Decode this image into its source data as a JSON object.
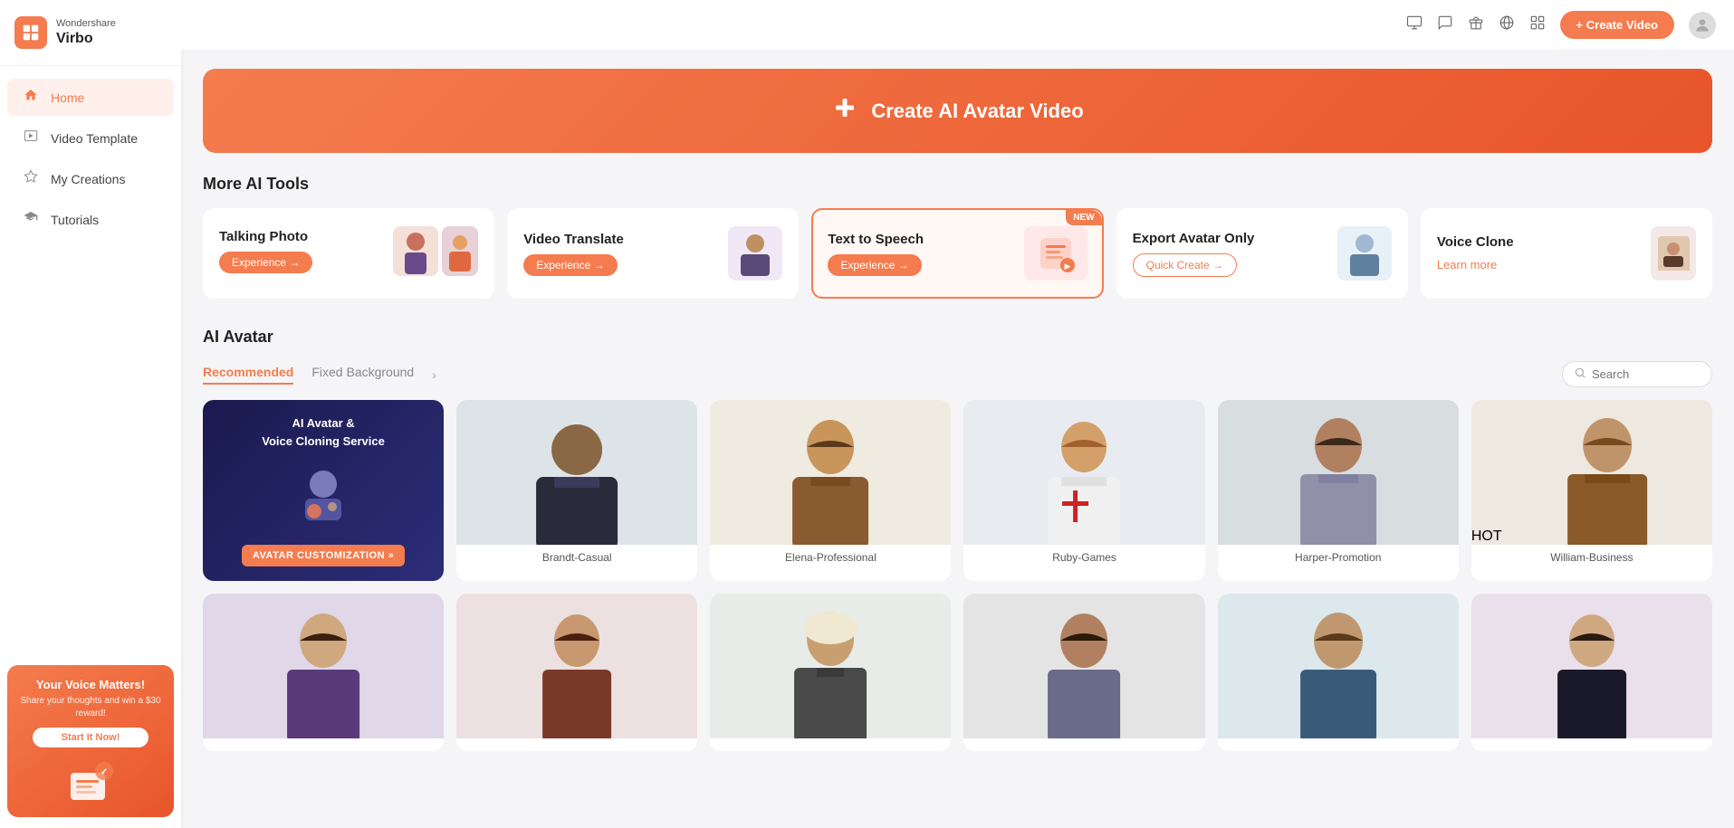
{
  "app": {
    "brand_top": "Wondershare",
    "brand_name": "Virbo",
    "logo_icon": "🎬"
  },
  "sidebar": {
    "items": [
      {
        "id": "home",
        "label": "Home",
        "icon": "🏠",
        "active": true
      },
      {
        "id": "video-template",
        "label": "Video Template",
        "icon": "📋",
        "active": false
      },
      {
        "id": "my-creations",
        "label": "My Creations",
        "icon": "🎓",
        "active": false
      },
      {
        "id": "tutorials",
        "label": "Tutorials",
        "icon": "🎓",
        "active": false
      }
    ]
  },
  "topbar": {
    "create_video_label": "+ Create Video",
    "icons": [
      "monitor",
      "message",
      "gift",
      "globe",
      "grid"
    ]
  },
  "voice_banner": {
    "title": "Your Voice Matters!",
    "desc": "Share your thoughts and win a $30 reward!",
    "button_label": "Start It Now!"
  },
  "hero": {
    "title": "Create AI Avatar Video",
    "icon": "➕"
  },
  "more_ai_tools": {
    "section_title": "More AI Tools",
    "tools": [
      {
        "id": "talking-photo",
        "title": "Talking Photo",
        "button_label": "Experience →",
        "button_type": "filled",
        "new_badge": false,
        "highlighted": false
      },
      {
        "id": "video-translate",
        "title": "Video Translate",
        "button_label": "Experience →",
        "button_type": "filled",
        "new_badge": false,
        "highlighted": false
      },
      {
        "id": "text-to-speech",
        "title": "Text to Speech",
        "button_label": "Experience →",
        "button_type": "filled",
        "new_badge": true,
        "badge_text": "NEW",
        "highlighted": true
      },
      {
        "id": "export-avatar",
        "title": "Export Avatar Only",
        "button_label": "Quick Create →",
        "button_type": "outline",
        "new_badge": false,
        "highlighted": false
      },
      {
        "id": "voice-clone",
        "title": "Voice Clone",
        "button_label": "Learn more",
        "button_type": "link",
        "new_badge": false,
        "highlighted": false
      }
    ]
  },
  "ai_avatar": {
    "section_title": "AI Avatar",
    "tabs": [
      {
        "id": "recommended",
        "label": "Recommended",
        "active": true
      },
      {
        "id": "fixed-background",
        "label": "Fixed Background",
        "active": false
      }
    ],
    "search_placeholder": "Search",
    "avatars": [
      {
        "id": "promo",
        "type": "promo",
        "title": "AI Avatar & Voice Cloning Service",
        "button_label": "AVATAR CUSTOMIZATION »"
      },
      {
        "id": "brandt",
        "name": "Brandt-Casual",
        "bg": "bg-light",
        "head_color": "head-medium",
        "body_color": "body-dark",
        "hot": false
      },
      {
        "id": "elena",
        "name": "Elena-Professional",
        "bg": "bg-beige",
        "head_color": "head-medium",
        "body_color": "body-brown",
        "hot": false
      },
      {
        "id": "ruby",
        "name": "Ruby-Games",
        "bg": "bg-light",
        "head_color": "head-light",
        "body_color": "body-white",
        "hot": false
      },
      {
        "id": "harper",
        "name": "Harper-Promotion",
        "bg": "bg-gray",
        "head_color": "head-dark",
        "body_color": "body-gray",
        "hot": false
      },
      {
        "id": "william",
        "name": "William-Business",
        "bg": "bg-beige",
        "head_color": "head-medium",
        "body_color": "body-brown",
        "hot": true
      }
    ],
    "avatars_row2": [
      {
        "id": "a7",
        "name": "",
        "bg": "bg-light"
      },
      {
        "id": "a8",
        "name": "",
        "bg": "bg-pink"
      },
      {
        "id": "a9",
        "name": "",
        "bg": "bg-beige"
      },
      {
        "id": "a10",
        "name": "",
        "bg": "bg-gray"
      },
      {
        "id": "a11",
        "name": "",
        "bg": "bg-light"
      },
      {
        "id": "a12",
        "name": "",
        "bg": "bg-green"
      }
    ]
  },
  "colors": {
    "brand_orange": "#f47c4e",
    "brand_orange_dark": "#e8552a",
    "sidebar_active_bg": "#fff0eb",
    "hero_gradient_start": "#f47c4e",
    "hero_gradient_end": "#e8552a"
  }
}
